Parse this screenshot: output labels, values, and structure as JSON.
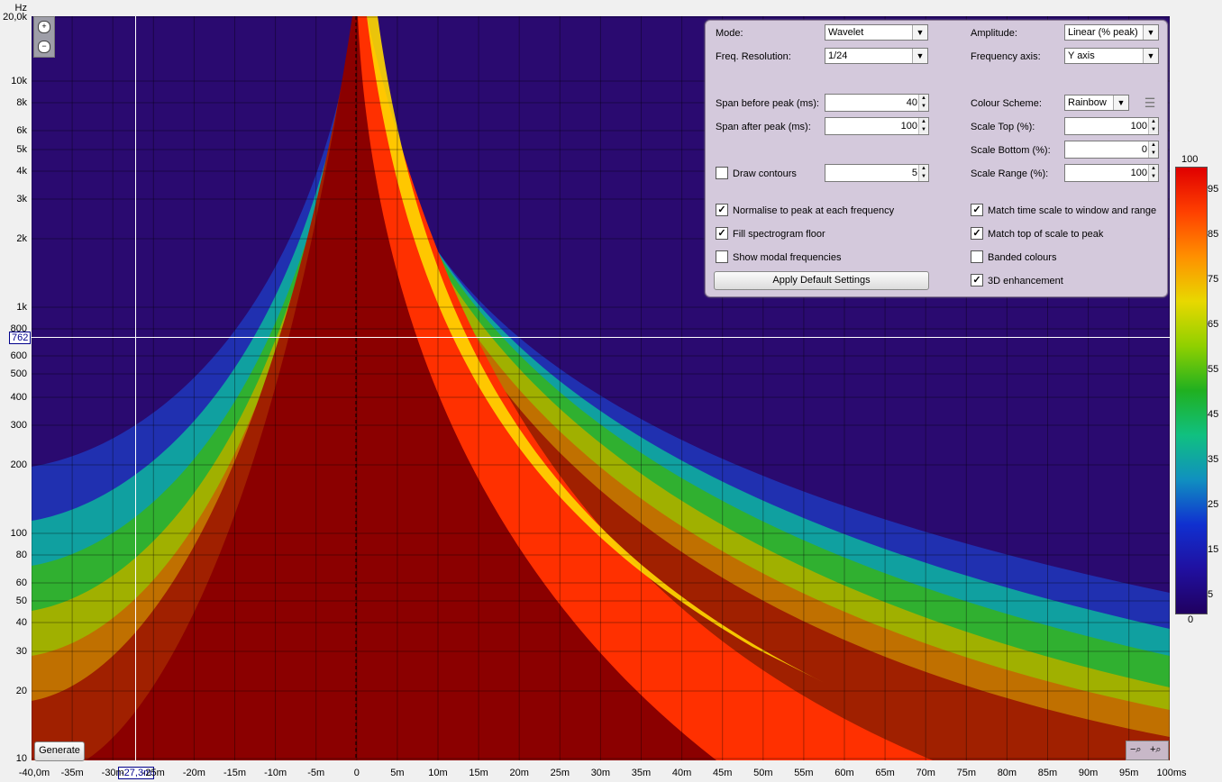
{
  "y_axis": {
    "unit": "Hz",
    "ticks": [
      "20,0k",
      "10k",
      "8k",
      "6k",
      "5k",
      "4k",
      "3k",
      "2k",
      "1k",
      "800",
      "600",
      "500",
      "400",
      "300",
      "200",
      "100",
      "80",
      "60",
      "50",
      "40",
      "30",
      "20",
      "10"
    ]
  },
  "x_axis": {
    "unit": "ms",
    "ticks": [
      "-40,0m",
      "-35m",
      "-30m",
      "-25m",
      "-20m",
      "-15m",
      "-10m",
      "-5m",
      "0",
      "5m",
      "10m",
      "15m",
      "20m",
      "25m",
      "30m",
      "35m",
      "40m",
      "45m",
      "50m",
      "55m",
      "60m",
      "65m",
      "70m",
      "75m",
      "80m",
      "85m",
      "90m",
      "95m",
      "100ms"
    ]
  },
  "cursor": {
    "x_label": "-27,3m",
    "y_label": "762"
  },
  "controls": {
    "mode_label": "Mode:",
    "mode_value": "Wavelet",
    "freq_res_label": "Freq. Resolution:",
    "freq_res_value": "1/24",
    "amplitude_label": "Amplitude:",
    "amplitude_value": "Linear (% peak)",
    "freq_axis_label": "Frequency axis:",
    "freq_axis_value": "Y axis",
    "span_before_label": "Span before peak (ms):",
    "span_before_value": "40",
    "span_after_label": "Span after peak (ms):",
    "span_after_value": "100",
    "colour_scheme_label": "Colour Scheme:",
    "colour_scheme_value": "Rainbow",
    "scale_top_label": "Scale Top (%):",
    "scale_top_value": "100",
    "scale_bottom_label": "Scale Bottom (%):",
    "scale_bottom_value": "0",
    "draw_contours_label": "Draw contours",
    "draw_contours_value": "5",
    "scale_range_label": "Scale Range (%):",
    "scale_range_value": "100",
    "normalise_label": "Normalise to peak at each frequency",
    "match_time_label": "Match time scale to window and range",
    "fill_floor_label": "Fill spectrogram floor",
    "match_top_label": "Match top of scale to peak",
    "show_modal_label": "Show modal frequencies",
    "banded_label": "Banded colours",
    "apply_default_label": "Apply Default Settings",
    "enhancement_label": "3D enhancement"
  },
  "checkboxes": {
    "draw_contours": false,
    "normalise": true,
    "match_time": true,
    "fill_floor": true,
    "match_top": true,
    "show_modal": false,
    "banded": false,
    "enhancement": true
  },
  "generate_label": "Generate",
  "colorbar": {
    "top_label": "100",
    "bottom_label": "0",
    "ticks": [
      "95",
      "85",
      "75",
      "65",
      "55",
      "45",
      "35",
      "25",
      "15",
      "5"
    ]
  },
  "icons": {
    "zoom_in": "plus-icon",
    "zoom_out": "minus-icon",
    "settings": "sliders-icon"
  }
}
